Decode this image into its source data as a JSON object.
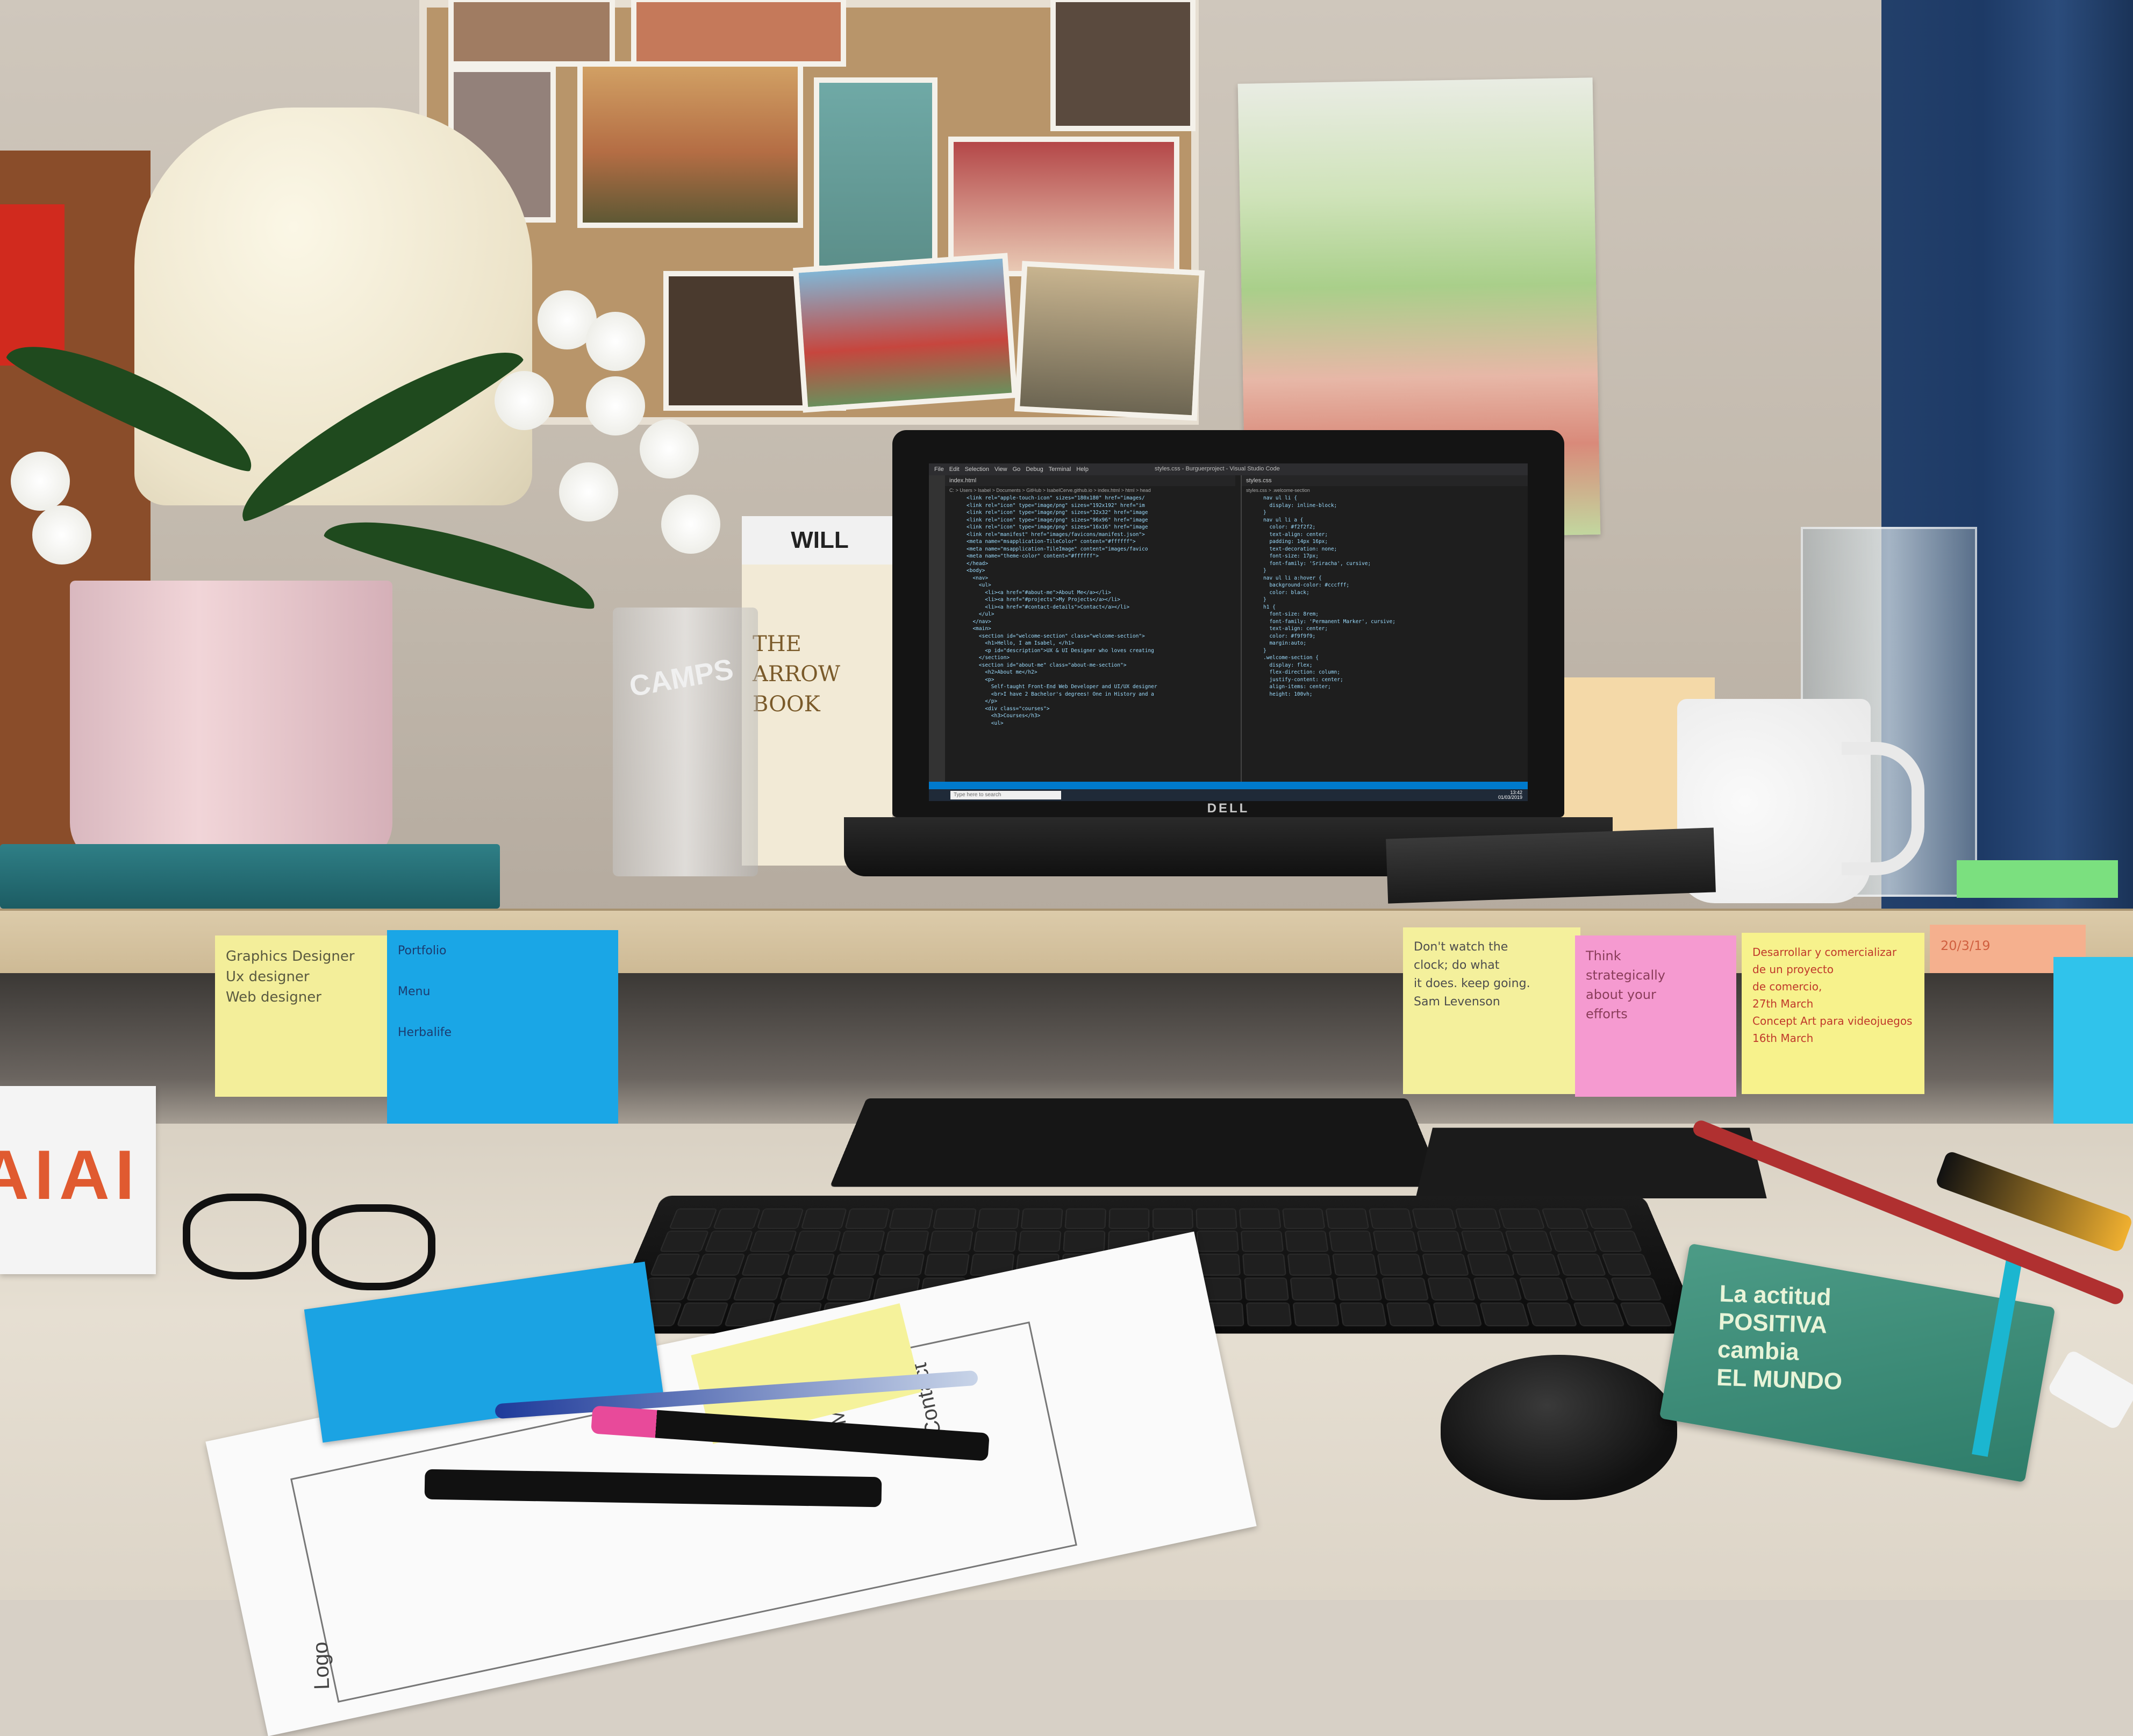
{
  "scene": {
    "description_colors": {
      "wall": "#c7bfb4",
      "desk": "#ddd5c8",
      "curtain": "#1f3c6a",
      "vscode_bg": "#1e1e1e",
      "statusbar": "#007acc"
    }
  },
  "laptop": {
    "brand": "DELL",
    "vscode": {
      "menu": [
        "File",
        "Edit",
        "Selection",
        "View",
        "Go",
        "Debug",
        "Terminal",
        "Help"
      ],
      "window_title": "styles.css - Burguerproject - Visual Studio Code",
      "tab_left": "index.html",
      "tab_right": "styles.css",
      "breadcrumb_left": "C: > Users > Isabel > Documents > GitHub > IsabelCerve.github.io > index.html > html > head",
      "breadcrumb_right": "styles.css > .welcome-section",
      "code_left": [
        "<link rel=\"apple-touch-icon\" sizes=\"180x180\" href=\"images/",
        "<link rel=\"icon\" type=\"image/png\" sizes=\"192x192\" href=\"im",
        "<link rel=\"icon\" type=\"image/png\" sizes=\"32x32\" href=\"image",
        "<link rel=\"icon\" type=\"image/png\" sizes=\"96x96\" href=\"image",
        "<link rel=\"icon\" type=\"image/png\" sizes=\"16x16\" href=\"image",
        "<link rel=\"manifest\" href=\"images/favicons/manifest.json\">",
        "<meta name=\"msapplication-TileColor\" content=\"#ffffff\">",
        "<meta name=\"msapplication-TileImage\" content=\"images/favico",
        "<meta name=\"theme-color\" content=\"#ffffff\">",
        "</head>",
        "<body>",
        "  <nav>",
        "    <ul>",
        "      <li><a href=\"#about-me\">About Me</a></li>",
        "      <li><a href=\"#projects\">My Projects</a></li>",
        "      <li><a href=\"#contact-details\">Contact</a></li>",
        "    </ul>",
        "  </nav>",
        "  <main>",
        "    <section id=\"welcome-section\" class=\"welcome-section\">",
        "      <h1>Hello, I am Isabel, </h1>",
        "      <p id=\"description\">UX & UI Designer who loves creating",
        "    </section>",
        "    <section id=\"about-me\" class=\"about-me-section\">",
        "      <h2>About me</h2>",
        "      <p>",
        "        Self-taught Front-End Web Developer and UI/UX designer",
        "        <br>I have 2 Bachelor's degrees! One in History and a",
        "      </p>",
        "      <div class=\"courses\">",
        "        <h3>Courses</h3>",
        "        <ul>"
      ],
      "code_right": [
        "nav ul li {",
        "  display: inline-block;",
        "}",
        "",
        "nav ul li a {",
        "  color: #f2f2f2;",
        "  text-align: center;",
        "  padding: 14px 16px;",
        "  text-decoration: none;",
        "  font-size: 17px;",
        "  font-family: 'Sriracha', cursive;",
        "}",
        "",
        "nav ul li a:hover {",
        "  background-color: #cccfff;",
        "  color: black;",
        "}",
        "",
        "h1 {",
        "  font-size: 8rem;",
        "  font-family: 'Permanent Marker', cursive;",
        "  text-align: center;",
        "  color: #f9f9f9;",
        "  margin:auto;",
        "}",
        "",
        ".welcome-section {",
        "  display: flex;",
        "  flex-direction: column;",
        "  justify-content: center;",
        "  align-items: center;",
        "  height: 100vh;"
      ],
      "taskbar_search": "Type here to search",
      "clock_time": "13:42",
      "clock_date": "01/03/2019"
    }
  },
  "sticky_notes": {
    "yellow_left": "Graphics Designer\nUx designer\nWeb designer",
    "blue_left": "Portfolio\n\nMenu\n\nHerbalife",
    "yellow_right": "Don't watch the\nclock; do what\nit does. keep going.\nSam Levenson",
    "pink": "Think\nstrategically\nabout your\nefforts",
    "yellow_far_right": "Desarrollar y comercializar\nde un proyecto\nde comercio,\n27th March\nConcept Art para videojuegos\n16th March",
    "peach": "20/3/19"
  },
  "objects": {
    "book_spine": "WILL GOMPERTZ",
    "book_cover": "THE\nARROW\nBOOK",
    "pen_cup_label": "CAMPS",
    "box_text": "AIAI",
    "notebook_green": "La actitud\nPOSITIVA\ncambia\nEL MUNDO",
    "sketch_labels": [
      "Logo",
      "PMs",
      "Contact"
    ]
  }
}
